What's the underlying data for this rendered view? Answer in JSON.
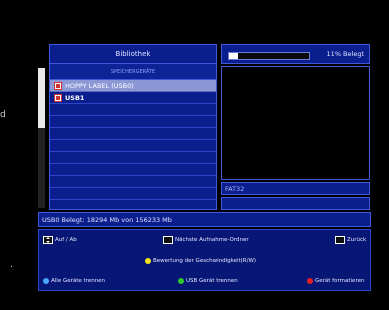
{
  "edge": {
    "left_fragment": "d",
    "bottom_fragment": "."
  },
  "library": {
    "title": "Bibliothek",
    "section": "SPEICHERGERÄTE"
  },
  "devices": [
    {
      "label": "HOPPY LABEL (USB0)",
      "icon": "usb-drive-icon",
      "selected": true
    },
    {
      "label": "USB1",
      "icon": "usb-drive-icon",
      "selected": false
    }
  ],
  "usage": {
    "fill_fraction": 0.11,
    "label": "11% Belegt"
  },
  "filesystem": "FAT32",
  "status": "USB0 Belegt: 18294 Mb von 156233 Mb",
  "footer": {
    "nav": "Auf / Ab",
    "next": "Nächste Aufnahme-Ordner",
    "back": "Zurück",
    "yellow": "Bewertung der Geschwindigkeit(R/W)",
    "blue": "Alle Geräte trennen",
    "green": "USB Gerät trennen",
    "red": "Gerät formatieren"
  },
  "colors": {
    "yellow": "#f4e21a",
    "blue": "#4aa8ff",
    "green": "#2cc92c",
    "red": "#e51f1f"
  }
}
